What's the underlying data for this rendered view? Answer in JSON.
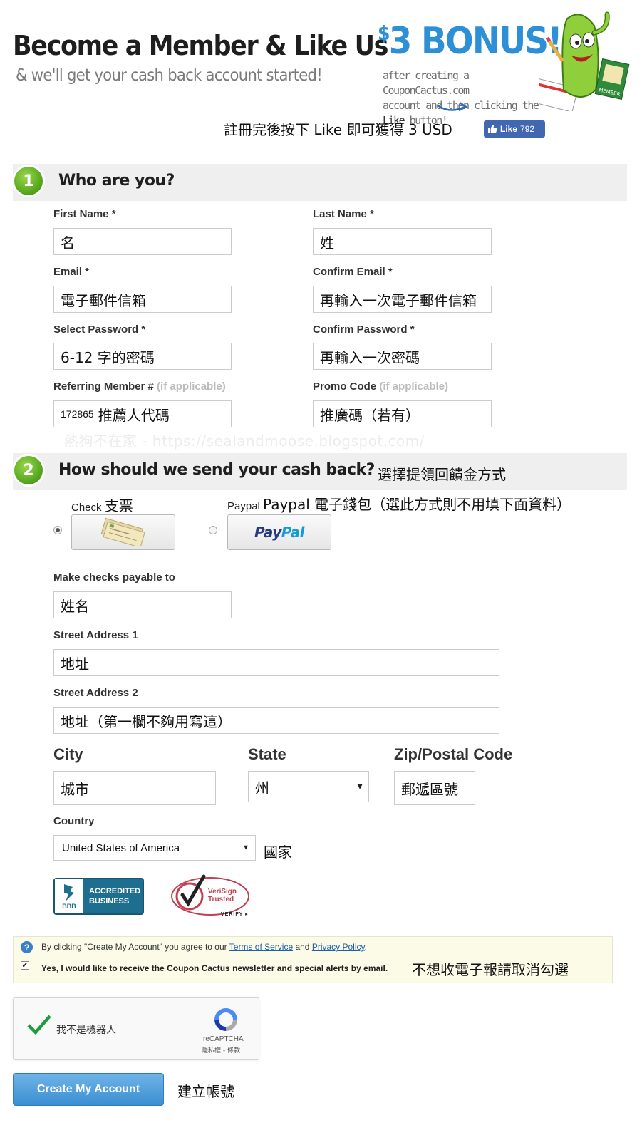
{
  "hero": {
    "title": "Become a Member & Like Us",
    "subtitle": "& we'll get your cash back account started!",
    "bonus_currency": "$",
    "bonus_amount": "3",
    "bonus_word": "BONUS!",
    "bonus_line1": "after creating a CouponCactus.com",
    "bonus_line2": "account and then clicking the",
    "bonus_like_word": "Like",
    "bonus_line3_rest": " button!",
    "member_card_text": "MEMBER",
    "annotation_zh": "註冊完後按下 Like 即可獲得 3 USD",
    "fb_like_label": "Like",
    "fb_like_count": "792"
  },
  "section1": {
    "number": "1",
    "title": "Who are you?",
    "fields": {
      "first_name": {
        "label": "First Name *",
        "value": "名"
      },
      "last_name": {
        "label": "Last Name *",
        "value": "姓"
      },
      "email": {
        "label": "Email *",
        "value": "電子郵件信箱"
      },
      "confirm_email": {
        "label": "Confirm Email *",
        "value": "再輸入一次電子郵件信箱"
      },
      "password": {
        "label": "Select Password *",
        "value": "6-12 字的密碼"
      },
      "confirm_password": {
        "label": "Confirm Password *",
        "value": "再輸入一次密碼"
      },
      "referring": {
        "label": "Referring Member #",
        "optional": "(if applicable)",
        "number": "172865",
        "value": "推薦人代碼"
      },
      "promo": {
        "label": "Promo Code",
        "optional": "(if applicable)",
        "value": "推廣碼（若有）"
      }
    },
    "watermark": "熱狗不在家 - https://sealandmoose.blogspot.com/"
  },
  "section2": {
    "number": "2",
    "title": "How should we send your cash back?",
    "annotation_zh": "選擇提領回饋金方式",
    "check_label": "Check",
    "check_label_zh": "支票",
    "paypal_label": "Paypal",
    "paypal_label_zh": "Paypal 電子錢包（選此方式則不用填下面資料）",
    "paypal_logo_pay": "Pay",
    "paypal_logo_pal": "Pal",
    "selected_method": "check",
    "payable_label": "Make checks payable to",
    "payable_value": "姓名",
    "street1_label": "Street Address 1",
    "street1_value": "地址",
    "street2_label": "Street Address 2",
    "street2_value": "地址（第一欄不夠用寫這）",
    "city_label": "City",
    "city_value": "城市",
    "state_label": "State",
    "state_value": "州",
    "zip_label": "Zip/Postal Code",
    "zip_value": "郵遞區號",
    "country_label": "Country",
    "country_value": "United States of America",
    "country_annotation_zh": "國家"
  },
  "badges": {
    "bbb_line1": "ACCREDITED",
    "bbb_line2": "BUSINESS",
    "bbb_logo": "BBB",
    "verisign_line1": "VeriSign",
    "verisign_line2": "Trusted",
    "verisign_verify": "VERIFY ▸"
  },
  "notice": {
    "prefix": "By clicking \"Create My Account\" you agree to our ",
    "terms": "Terms of Service",
    "and": " and ",
    "privacy": "Privacy Policy",
    "suffix": ".",
    "newsletter": "Yes, I would like to receive the Coupon Cactus newsletter and special alerts by email.",
    "newsletter_checked": true,
    "annotation_zh": "不想收電子報請取消勾選"
  },
  "captcha": {
    "label": "我不是機器人",
    "brand": "reCAPTCHA",
    "links": "隱私權 - 條款"
  },
  "submit": {
    "label": "Create My Account",
    "annotation_zh": "建立帳號"
  },
  "colors": {
    "accent_blue": "#2d8fd6",
    "step_green": "#4fa21a",
    "button_blue": "#3b8fd1",
    "fb_blue": "#4267b2",
    "notice_bg": "#fbfbe8"
  }
}
